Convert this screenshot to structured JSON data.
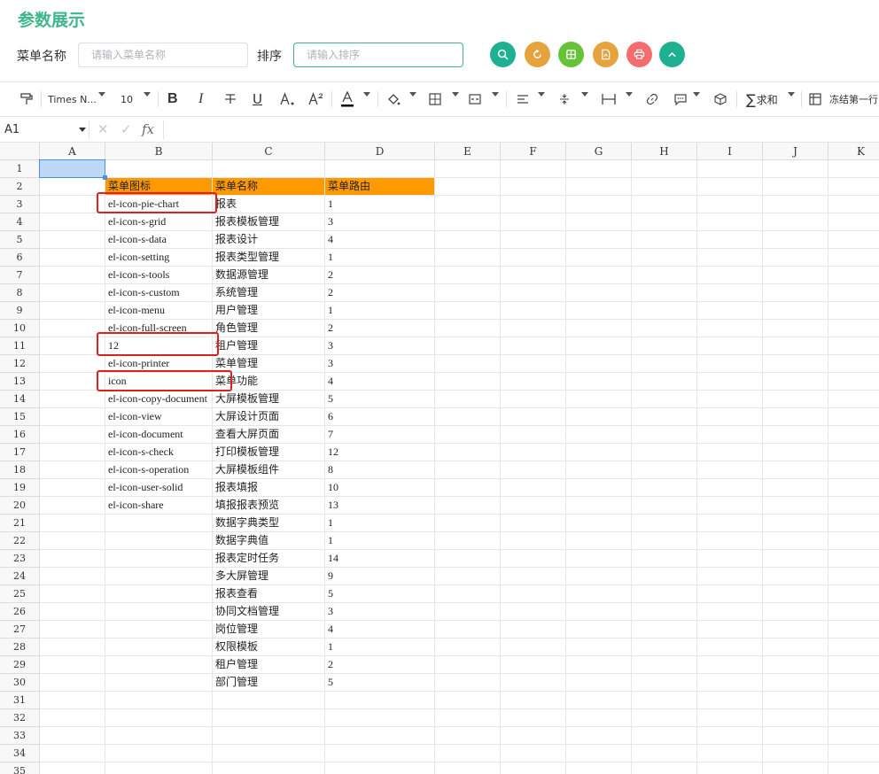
{
  "page_title": "参数展示",
  "search": {
    "menu_name_label": "菜单名称",
    "menu_name_placeholder": "请输入菜单名称",
    "sort_label": "排序",
    "sort_placeholder": "请输入排序"
  },
  "action_buttons": [
    {
      "name": "search-button",
      "icon": "search-icon",
      "color": "#1eb090"
    },
    {
      "name": "reset-button",
      "icon": "refresh-icon",
      "color": "#e6a23c"
    },
    {
      "name": "excel-export-button",
      "icon": "excel-icon",
      "color": "#67c23a"
    },
    {
      "name": "pdf-export-button",
      "icon": "pdf-icon",
      "color": "#e6a23c"
    },
    {
      "name": "print-button",
      "icon": "print-icon",
      "color": "#f56c6c"
    },
    {
      "name": "collapse-button",
      "icon": "chevron-up-icon",
      "color": "#1eb090"
    }
  ],
  "toolbar": {
    "font_name": "Times N...",
    "font_size": "10",
    "bold": "B",
    "italic": "I",
    "underline": "U",
    "sum_label": "求和",
    "freeze_label": "冻结第一行"
  },
  "formula_bar": {
    "cell_ref": "A1",
    "fx": "fx"
  },
  "columns": [
    "A",
    "B",
    "C",
    "D",
    "E",
    "F",
    "G",
    "H",
    "I",
    "J",
    "K"
  ],
  "row_count": 35,
  "header_row": [
    "菜单图标",
    "菜单名称",
    "菜单路由"
  ],
  "rows": [
    [
      "el-icon-pie-chart",
      "报表",
      "1"
    ],
    [
      "el-icon-s-grid",
      "报表模板管理",
      "3"
    ],
    [
      "el-icon-s-data",
      "报表设计",
      "4"
    ],
    [
      "el-icon-setting",
      "报表类型管理",
      "1"
    ],
    [
      "el-icon-s-tools",
      "数据源管理",
      "2"
    ],
    [
      "el-icon-s-custom",
      "系统管理",
      "2"
    ],
    [
      "el-icon-menu",
      "用户管理",
      "1"
    ],
    [
      "el-icon-full-screen",
      "角色管理",
      "2"
    ],
    [
      "12",
      "租户管理",
      "3"
    ],
    [
      "el-icon-printer",
      "菜单管理",
      "3"
    ],
    [
      "icon",
      "菜单功能",
      "4"
    ],
    [
      "el-icon-copy-document",
      "大屏模板管理",
      "5"
    ],
    [
      "el-icon-view",
      "大屏设计页面",
      "6"
    ],
    [
      "el-icon-document",
      "查看大屏页面",
      "7"
    ],
    [
      "el-icon-s-check",
      "打印模板管理",
      "12"
    ],
    [
      "el-icon-s-operation",
      "大屏模板组件",
      "8"
    ],
    [
      "el-icon-user-solid",
      "报表填报",
      "10"
    ],
    [
      "el-icon-share",
      "填报报表预览",
      "13"
    ],
    [
      "",
      "数据字典类型",
      "1"
    ],
    [
      "",
      "数据字典值",
      "1"
    ],
    [
      "",
      "报表定时任务",
      "14"
    ],
    [
      "",
      "多大屏管理",
      "9"
    ],
    [
      "",
      "报表查看",
      "5"
    ],
    [
      "",
      "协同文档管理",
      "3"
    ],
    [
      "",
      "岗位管理",
      "4"
    ],
    [
      "",
      "权限模板",
      "1"
    ],
    [
      "",
      "租户管理",
      "2"
    ],
    [
      "",
      "部门管理",
      "5"
    ]
  ],
  "colors": {
    "accent": "#3fb58a",
    "header_fill": "#ff9900",
    "selection": "#bdd7f5",
    "highlight_box": "#e02020"
  }
}
